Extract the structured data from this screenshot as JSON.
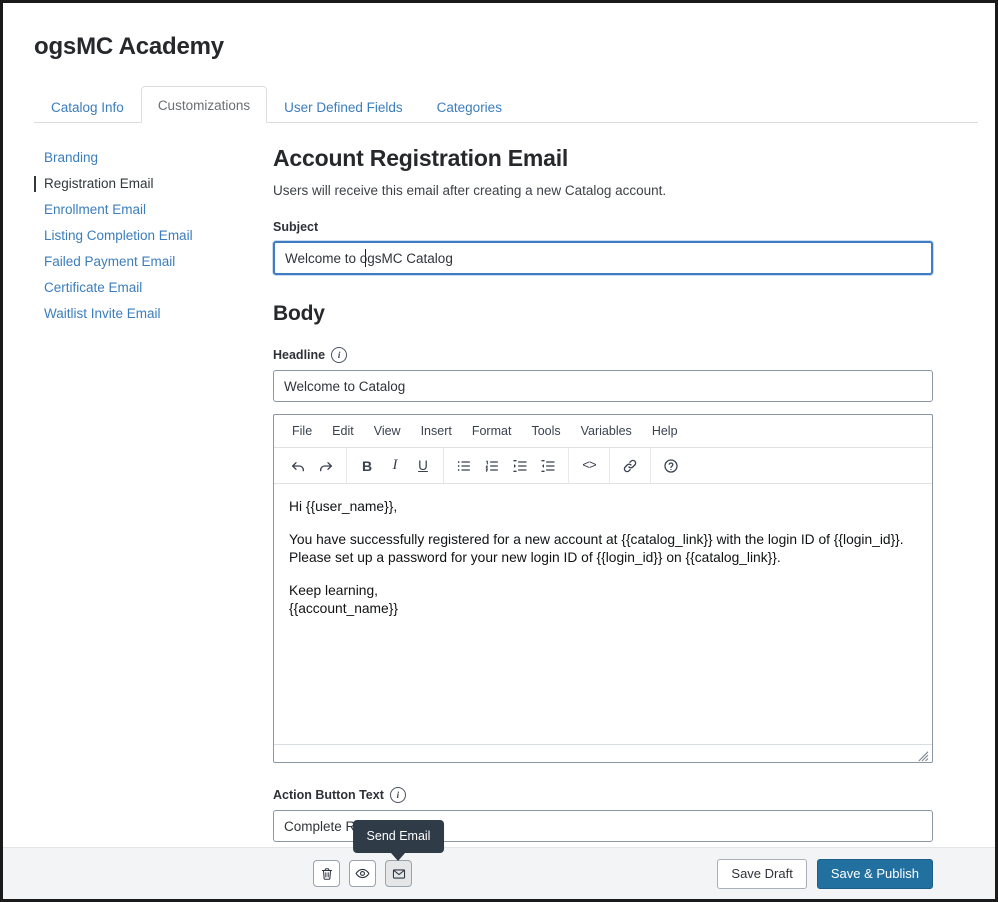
{
  "app": {
    "title": "ogsMC Academy"
  },
  "tabs": [
    {
      "label": "Catalog Info",
      "active": false
    },
    {
      "label": "Customizations",
      "active": true
    },
    {
      "label": "User Defined Fields",
      "active": false
    },
    {
      "label": "Categories",
      "active": false
    }
  ],
  "sidebar": {
    "items": [
      {
        "label": "Branding",
        "active": false
      },
      {
        "label": "Registration Email",
        "active": true
      },
      {
        "label": "Enrollment Email",
        "active": false
      },
      {
        "label": "Listing Completion Email",
        "active": false
      },
      {
        "label": "Failed Payment Email",
        "active": false
      },
      {
        "label": "Certificate Email",
        "active": false
      },
      {
        "label": "Waitlist Invite Email",
        "active": false
      }
    ]
  },
  "main": {
    "page_title": "Account Registration Email",
    "page_description": "Users will receive this email after creating a new Catalog account.",
    "subject": {
      "label": "Subject",
      "value": "Welcome to ogsMC Catalog",
      "focused": true
    },
    "body_section_title": "Body",
    "headline": {
      "label": "Headline",
      "value": "Welcome to Catalog",
      "info_icon": "info-icon"
    },
    "action_button_text": {
      "label": "Action Button Text",
      "value": "Complete Registration",
      "info_icon": "info-icon"
    }
  },
  "editor": {
    "menu": [
      "File",
      "Edit",
      "View",
      "Insert",
      "Format",
      "Tools",
      "Variables",
      "Help"
    ],
    "toolbar_groups": [
      [
        "undo-icon",
        "redo-icon"
      ],
      [
        "bold-icon",
        "italic-icon",
        "underline-icon"
      ],
      [
        "bullet-list-icon",
        "numbered-list-icon",
        "indent-increase-icon",
        "indent-decrease-icon"
      ],
      [
        "source-code-icon"
      ],
      [
        "link-icon"
      ],
      [
        "help-icon"
      ]
    ],
    "content_paragraphs": [
      "Hi {{user_name}},",
      "You have successfully registered for a new account at {{catalog_link}} with the login ID of {{login_id}}.\nPlease set up a password for your new login ID of {{login_id}} on {{catalog_link}}.",
      "Keep learning,\n{{account_name}}"
    ]
  },
  "footer": {
    "icon_buttons": [
      {
        "name": "delete-button",
        "icon": "trash-icon",
        "hovered": false
      },
      {
        "name": "preview-button",
        "icon": "eye-icon",
        "hovered": false
      },
      {
        "name": "send-email-button",
        "icon": "envelope-icon",
        "hovered": true
      }
    ],
    "tooltip": "Send Email",
    "save_draft_label": "Save Draft",
    "save_publish_label": "Save & Publish"
  },
  "colors": {
    "link_blue": "#3b7dbd",
    "primary_button": "#21709f",
    "focus_border": "#3f7cc4",
    "tooltip_bg": "#2f3b47",
    "text_dark": "#26282b"
  }
}
